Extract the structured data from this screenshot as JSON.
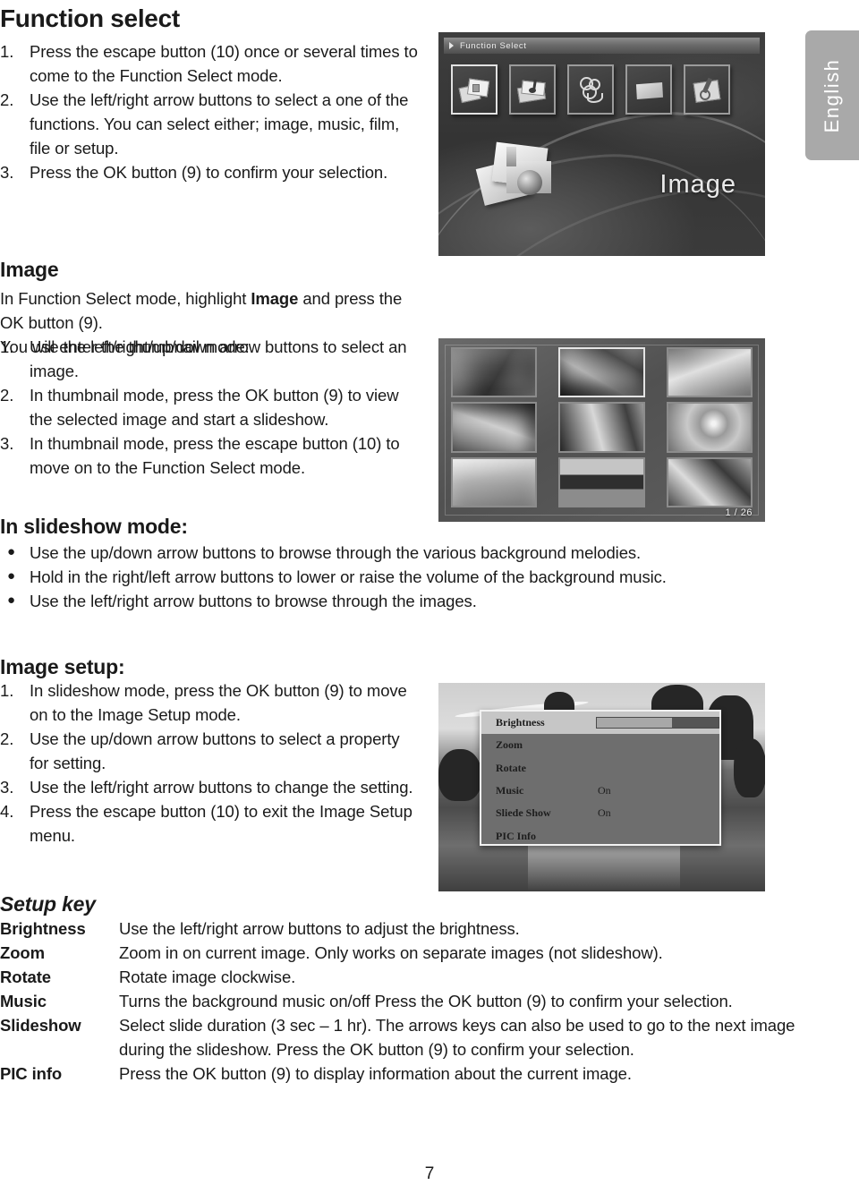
{
  "page": {
    "title": "Function select",
    "number": "7",
    "language_tab": "English"
  },
  "function_select": {
    "steps": [
      {
        "num": "1.",
        "text": "Press the escape button (10) once or several times to come to the Function Select mode."
      },
      {
        "num": "2.",
        "text": "Use the left/right arrow buttons to select a one of the functions. You can select either; image, music, film, file or setup."
      },
      {
        "num": "3.",
        "text": "Press the OK button (9) to confirm your selection."
      }
    ]
  },
  "image_section": {
    "heading": "Image",
    "intro_before": "In Function Select mode, highlight ",
    "intro_bold": "Image",
    "intro_after": " and press the OK button (9).",
    "intro_line2": "You will enter the thumbnail mode:",
    "steps": [
      {
        "num": "1.",
        "text": "Use the left/right/up/down arrow buttons to select an image."
      },
      {
        "num": "2.",
        "text": "In thumbnail mode, press the OK button (9) to view the selected image and start a slideshow."
      },
      {
        "num": "3.",
        "text": "In thumbnail mode, press the escape button (10) to move on to the Function Select mode."
      }
    ]
  },
  "slideshow_mode": {
    "heading": "In slideshow mode:",
    "bullets": [
      "Use the up/down arrow buttons to browse through the various background melodies.",
      "Hold in the right/left arrow buttons to lower or raise the volume of the background music.",
      "Use the left/right arrow buttons to browse through the images."
    ]
  },
  "image_setup": {
    "heading": "Image setup:",
    "steps": [
      {
        "num": "1.",
        "text": "In slideshow mode, press the OK button (9) to move on to the Image Setup mode."
      },
      {
        "num": "2.",
        "text": "Use the up/down arrow buttons to select a property for setting."
      },
      {
        "num": "3.",
        "text": "Use the left/right arrow buttons to change the setting."
      },
      {
        "num": "4.",
        "text": "Press the escape button (10) to exit the Image Setup menu."
      }
    ]
  },
  "setup_key": {
    "heading": "Setup key",
    "rows": [
      {
        "key": "Brightness",
        "desc": "Use the left/right arrow buttons to adjust the brightness."
      },
      {
        "key": "Zoom",
        "desc": "Zoom in on current image. Only works on separate images (not slideshow)."
      },
      {
        "key": "Rotate",
        "desc": "Rotate image clockwise."
      },
      {
        "key": "Music",
        "desc": "Turns the background music on/off Press the OK button (9) to confirm your selection."
      },
      {
        "key": "Slideshow",
        "desc": "Select slide duration (3 sec – 1 hr). The arrows keys can also be used to go to the next image during the slideshow. Press the OK button (9) to confirm your selection."
      },
      {
        "key": "PIC info",
        "desc": "Press the OK button (9) to display information about the current image."
      }
    ]
  },
  "screenshot_function_select": {
    "titlebar": "Function Select",
    "selected_label": "Image",
    "icons": [
      "image-icon",
      "music-icon",
      "film-icon",
      "file-icon",
      "setup-icon"
    ]
  },
  "screenshot_thumbnails": {
    "counter": "1 / 26"
  },
  "screenshot_image_setup": {
    "menu": [
      {
        "label": "Brightness",
        "value": "",
        "selected": true,
        "slider": 62
      },
      {
        "label": "Zoom",
        "value": "",
        "selected": false
      },
      {
        "label": "Rotate",
        "value": "",
        "selected": false
      },
      {
        "label": "Music",
        "value": "On",
        "selected": false
      },
      {
        "label": "Sliede Show",
        "value": "On",
        "selected": false
      },
      {
        "label": "PIC Info",
        "value": "",
        "selected": false
      }
    ]
  }
}
